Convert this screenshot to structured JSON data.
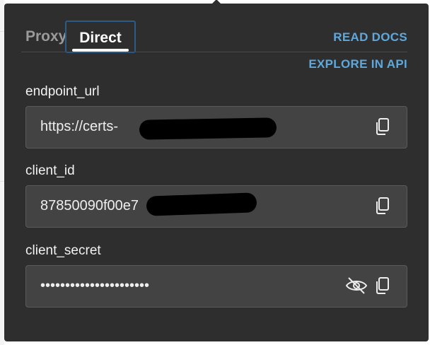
{
  "tabs": [
    {
      "label": "Proxy",
      "active": false
    },
    {
      "label": "Direct",
      "active": true
    }
  ],
  "links": {
    "read_docs": "READ DOCS",
    "explore_api": "EXPLORE IN API"
  },
  "fields": [
    {
      "label": "endpoint_url",
      "value": "https://certs-",
      "redacted": true
    },
    {
      "label": "client_id",
      "value": "87850090f00e7",
      "redacted": true
    },
    {
      "label": "client_secret",
      "value": "••••••••••••••••••••••",
      "masked": true
    }
  ],
  "icons": {
    "copy": "copy-icon",
    "visibility": "eye-slash-icon"
  },
  "colors": {
    "popover_bg": "#2e2e2e",
    "field_bg": "#434343",
    "link": "#5fa8dc",
    "active_tab_border": "#2b5b86"
  }
}
